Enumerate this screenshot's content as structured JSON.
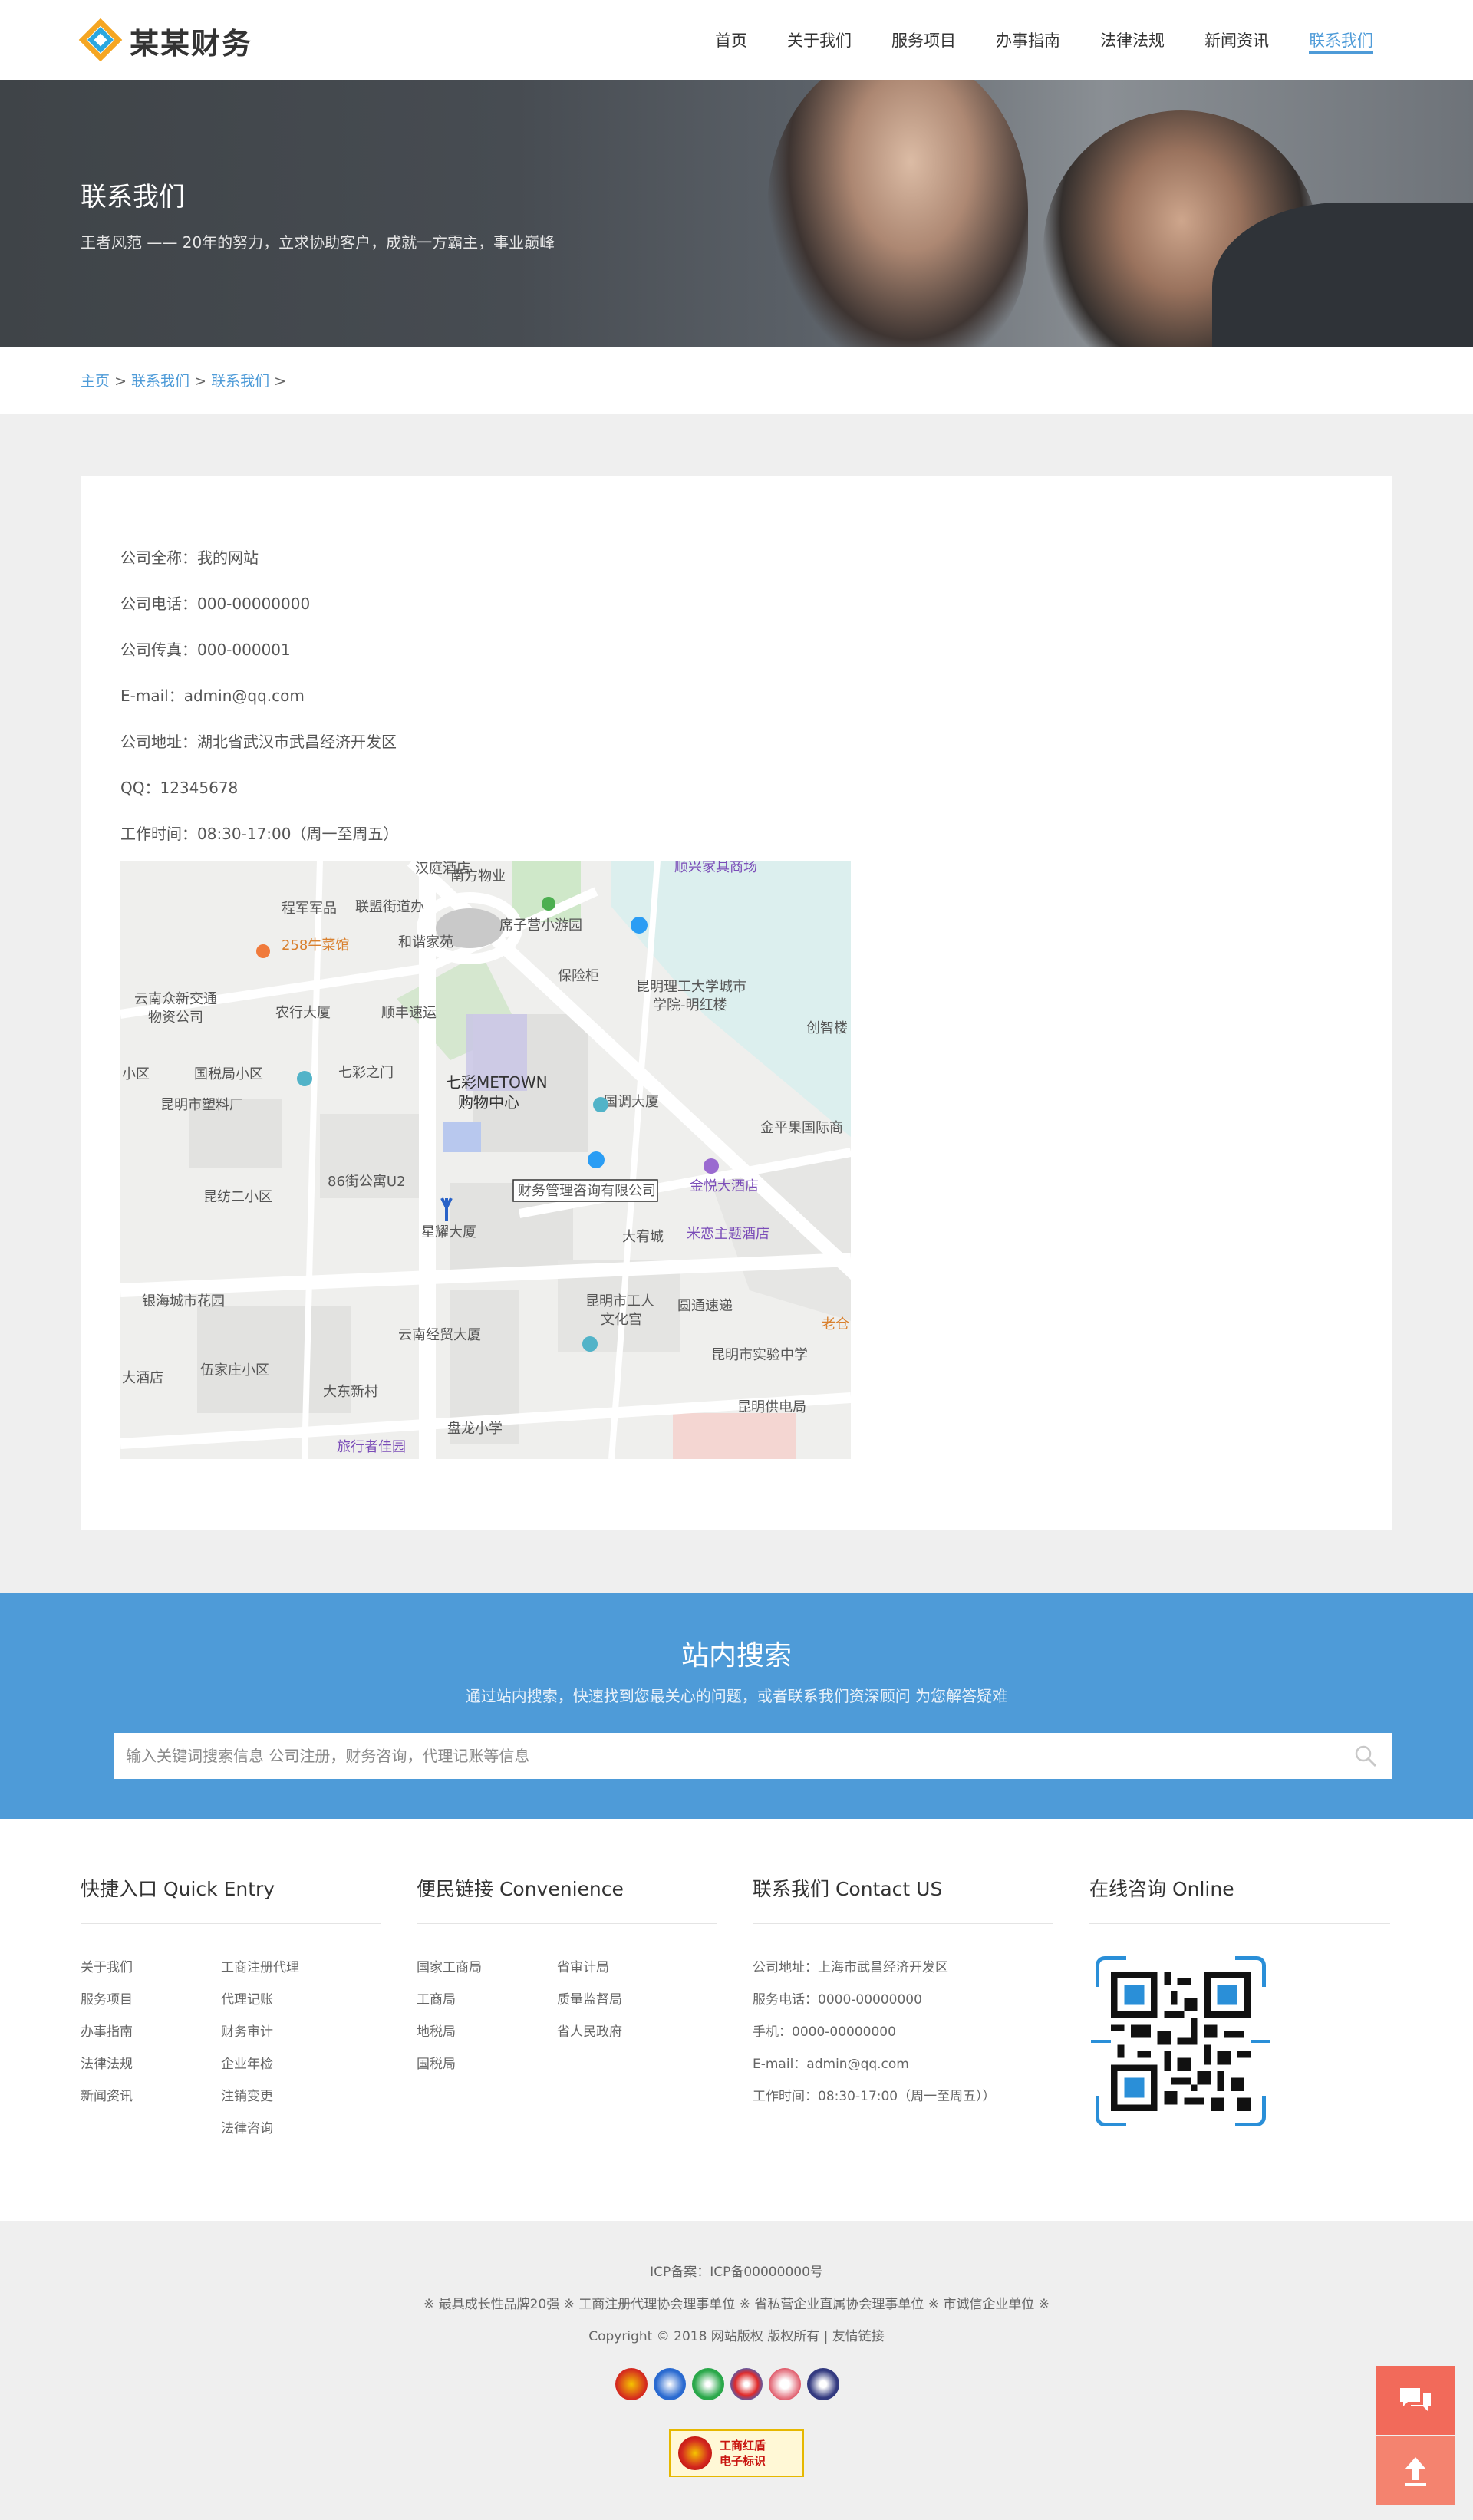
{
  "header": {
    "brand": "某某财务",
    "nav": [
      "首页",
      "关于我们",
      "服务项目",
      "办事指南",
      "法律法规",
      "新闻资讯",
      "联系我们"
    ],
    "active_nav": "联系我们"
  },
  "banner": {
    "title": "联系我们",
    "subtitle": "王者风范 —— 20年的努力，立求协助客户，成就一方霸主，事业巅峰"
  },
  "breadcrumb": {
    "items": [
      "主页",
      "联系我们",
      "联系我们"
    ],
    "separator": ">"
  },
  "contact": {
    "rows": [
      "公司全称：我的网站",
      "公司电话：000-00000000",
      "公司传真：000-000001",
      "E-mail：admin@qq.com",
      "公司地址：湖北省武汉市武昌经济开发区",
      "QQ：12345678",
      "工作时间：08:30-17:00（周一至周五）"
    ]
  },
  "map": {
    "labels": [
      "汉庭酒店",
      "南方物业",
      "顺兴家具商场",
      "程军军品",
      "联盟街道办",
      "席子营小游园",
      "258牛菜馆",
      "和谐家苑",
      "保险柜",
      "昆明理工大学城市",
      "学院-明红楼",
      "云南众新交通",
      "物资公司",
      "农行大厦",
      "顺丰速运",
      "创智楼",
      "小区",
      "国税局小区",
      "七彩之门",
      "七彩METOWN",
      "购物中心",
      "国调大厦",
      "昆明市塑料厂",
      "金平果国际商",
      "昆纺二小区",
      "86街公寓U2",
      "金悦大酒店",
      "财务管理咨询有限公司",
      "星耀大厦",
      "大宥城",
      "米恋主题酒店",
      "银海城市花园",
      "昆明市工人",
      "文化宫",
      "圆通速递",
      "老仓",
      "云南经贸大厦",
      "昆明市实验中学",
      "大酒店",
      "伍家庄小区",
      "大东新村",
      "昆明供电局",
      "盘龙小学",
      "旅行者佳园"
    ],
    "marker_label": "财务管理咨询有限公司"
  },
  "search": {
    "title": "站内搜索",
    "subtitle": "通过站内搜索，快速找到您最关心的问题，或者联系我们资深顾问 为您解答疑难",
    "placeholder": "输入关键词搜索信息 公司注册，财务咨询，代理记账等信息"
  },
  "footer": {
    "quick": {
      "title": "快捷入口 Quick Entry",
      "col1": [
        "关于我们",
        "服务项目",
        "办事指南",
        "法律法规",
        "新闻资讯"
      ],
      "col2": [
        "工商注册代理",
        "代理记账",
        "财务审计",
        "企业年检",
        "注销变更",
        "法律咨询"
      ]
    },
    "convenience": {
      "title": "便民链接 Convenience",
      "col1": [
        "国家工商局",
        "工商局",
        "地税局",
        "国税局"
      ],
      "col2": [
        "省审计局",
        "质量监督局",
        "省人民政府"
      ]
    },
    "contact": {
      "title": "联系我们 Contact US",
      "items": [
        "公司地址：上海市武昌经济开发区",
        "服务电话：0000-00000000",
        "手机：0000-00000000",
        "E-mail：admin@qq.com",
        "工作时间：08:30-17:00（周一至周五））"
      ]
    },
    "online": {
      "title": "在线咨询 Online"
    }
  },
  "bottom": {
    "icp": "ICP备案：ICP备00000000号",
    "honors": "※ 最具成长性品牌20强 ※ 工商注册代理协会理事单位 ※ 省私营企业直属协会理事单位 ※ 市诚信企业单位 ※",
    "copyright": "Copyright © 2018 网站版权 版权所有 | 友情链接",
    "redshield_line1": "工商红盾",
    "redshield_line2": "电子标识"
  },
  "colors": {
    "accent": "#4e9bd8",
    "logo_orange": "#f5a623",
    "logo_blue": "#2aa7e0",
    "float": "#f26a5a"
  },
  "icons": {
    "chat": "chat-bubbles-icon",
    "top": "arrow-up-icon",
    "search": "search-icon"
  }
}
